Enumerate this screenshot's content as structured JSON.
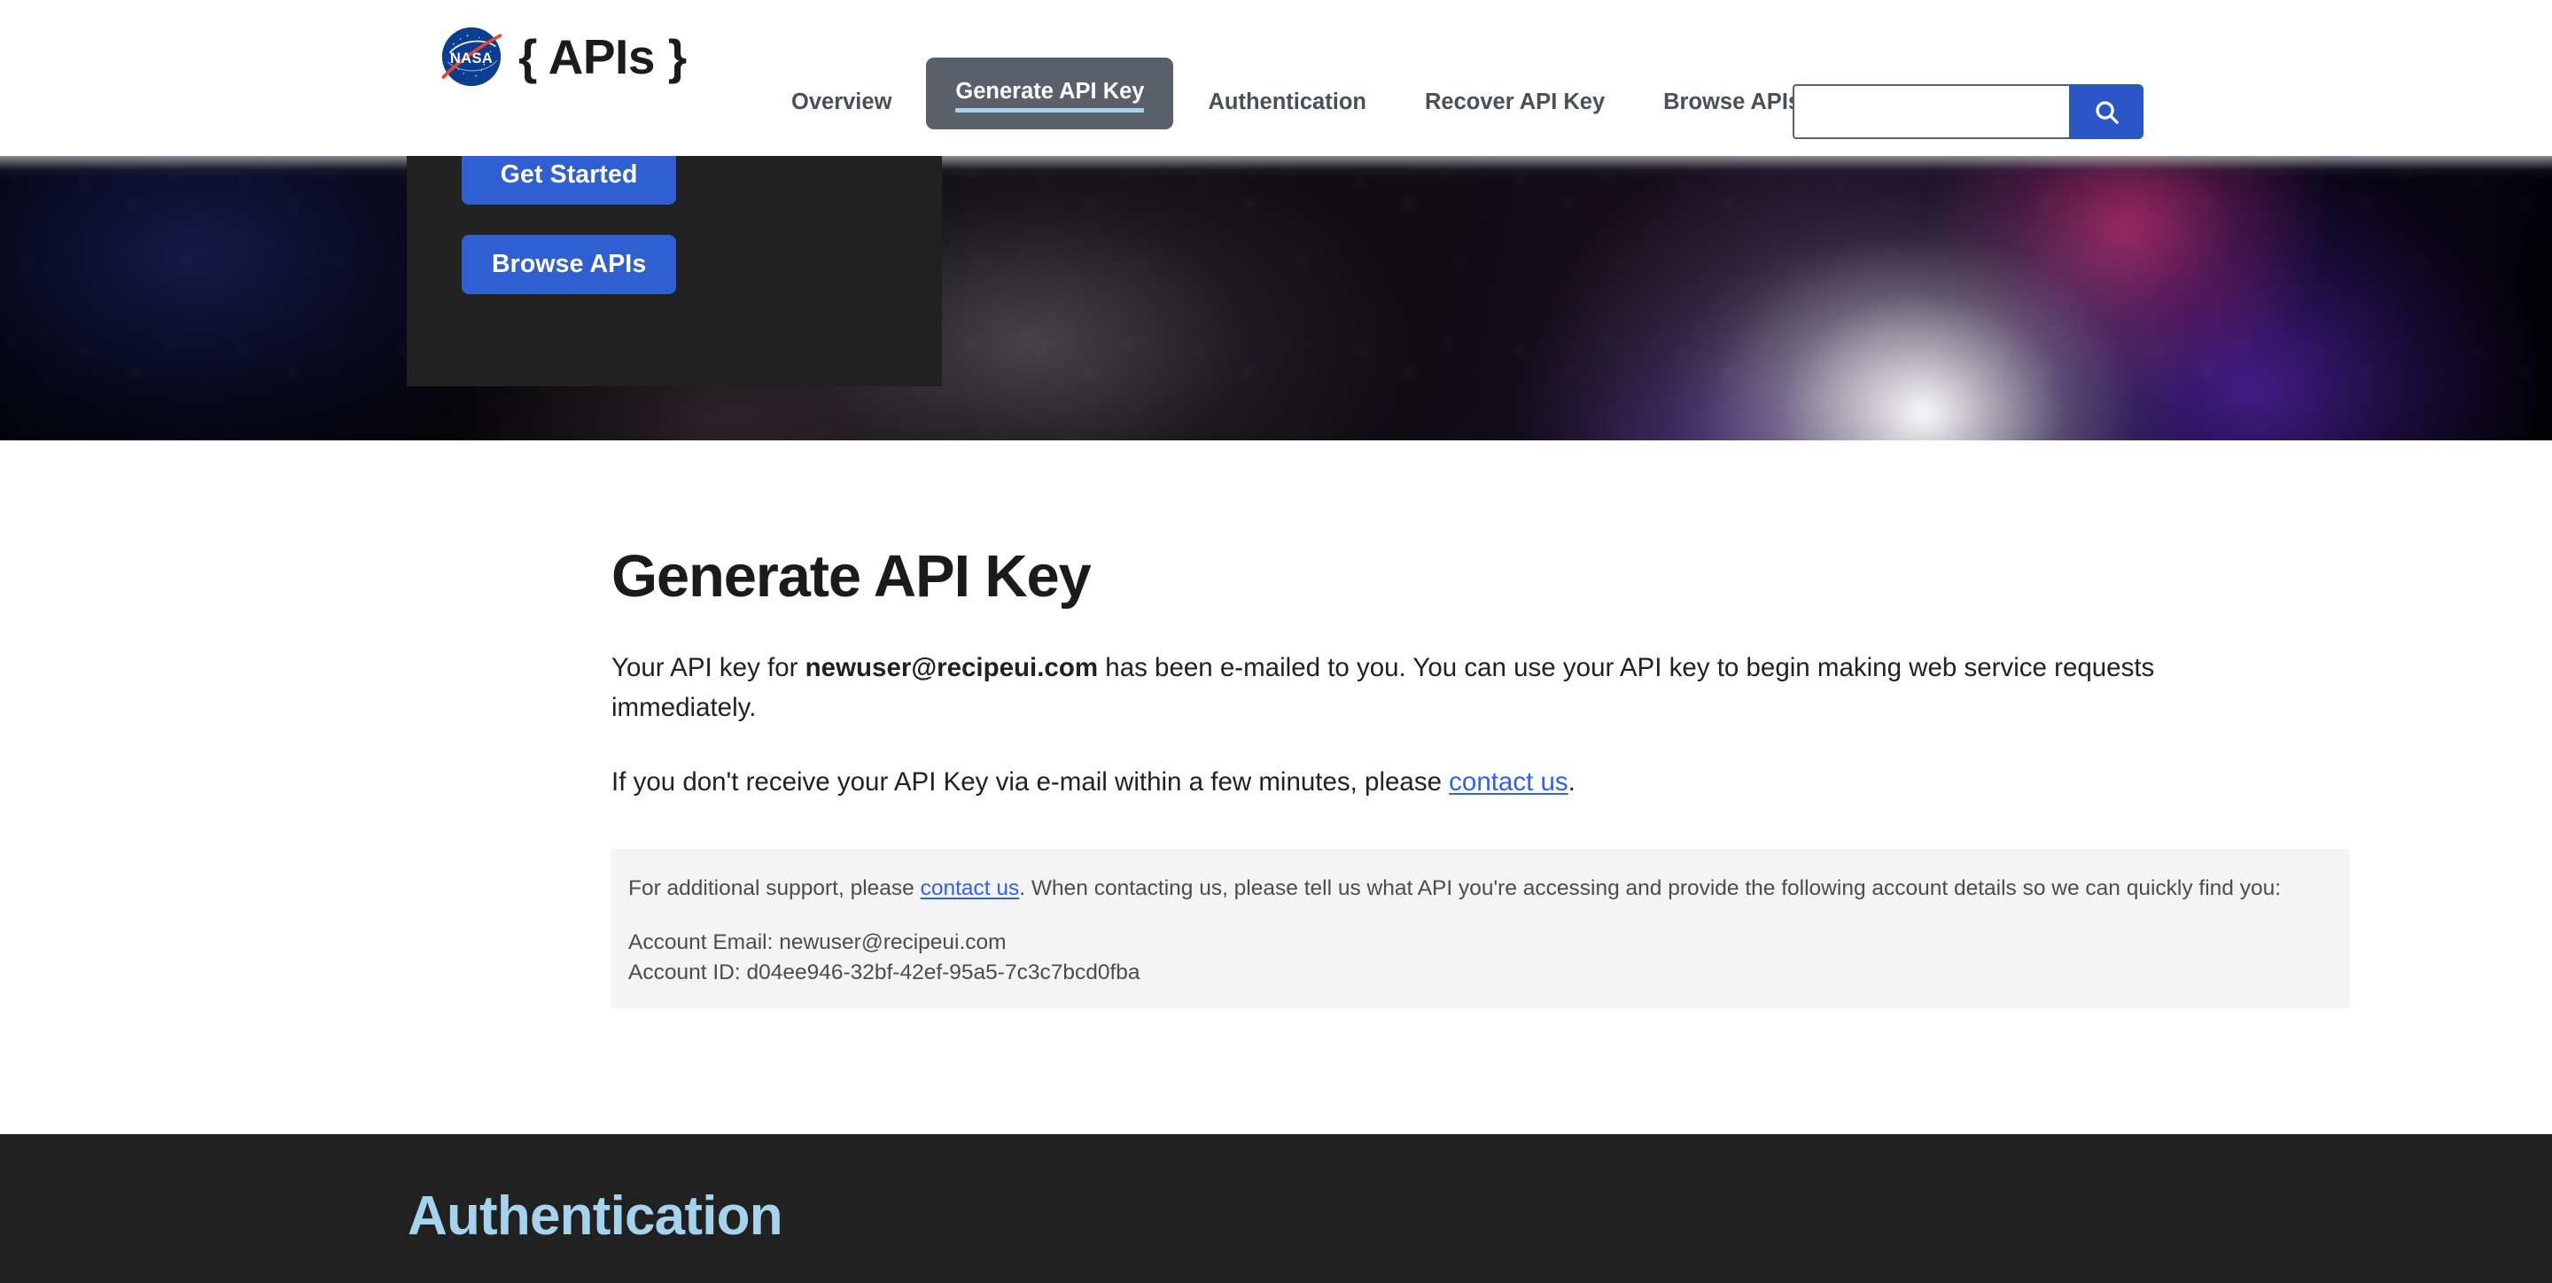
{
  "header": {
    "brand_title": "{ APIs }",
    "logo_alt": "NASA",
    "nav": [
      {
        "label": "Overview",
        "active": false
      },
      {
        "label": "Generate API Key",
        "active": true
      },
      {
        "label": "Authentication",
        "active": false
      },
      {
        "label": "Recover API Key",
        "active": false
      },
      {
        "label": "Browse APIs",
        "active": false
      }
    ],
    "search": {
      "value": "",
      "placeholder": "",
      "icon": "search-icon",
      "button_color": "#2a56c6"
    }
  },
  "hero": {
    "buttons": [
      {
        "label": "Get Started"
      },
      {
        "label": "Browse APIs"
      }
    ],
    "panel_color": "#212121",
    "button_color": "#2f5fd0"
  },
  "main": {
    "page_title": "Generate API Key",
    "paragraph_1": {
      "before": "Your API key for ",
      "email": "newuser@recipeui.com",
      "after": " has been e-mailed to you. You can use your API key to begin making web service requests immediately."
    },
    "paragraph_2": {
      "before": "If you don't receive your API Key via e-mail within a few minutes, please ",
      "link": "contact us",
      "after": "."
    },
    "support_box": {
      "before": "For additional support, please ",
      "link": "contact us",
      "after": ". When contacting us, please tell us what API you're accessing and provide the following account details so we can quickly find you:",
      "account_email_label": "Account Email: ",
      "account_email": "newuser@recipeui.com",
      "account_id_label": "Account ID: ",
      "account_id": "d04ee946-32bf-42ef-95a5-7c3c7bcd0fba",
      "background": "#f4f4f4"
    }
  },
  "auth_section": {
    "title": "Authentication",
    "background": "#212121",
    "title_color": "#a5d3ed"
  }
}
